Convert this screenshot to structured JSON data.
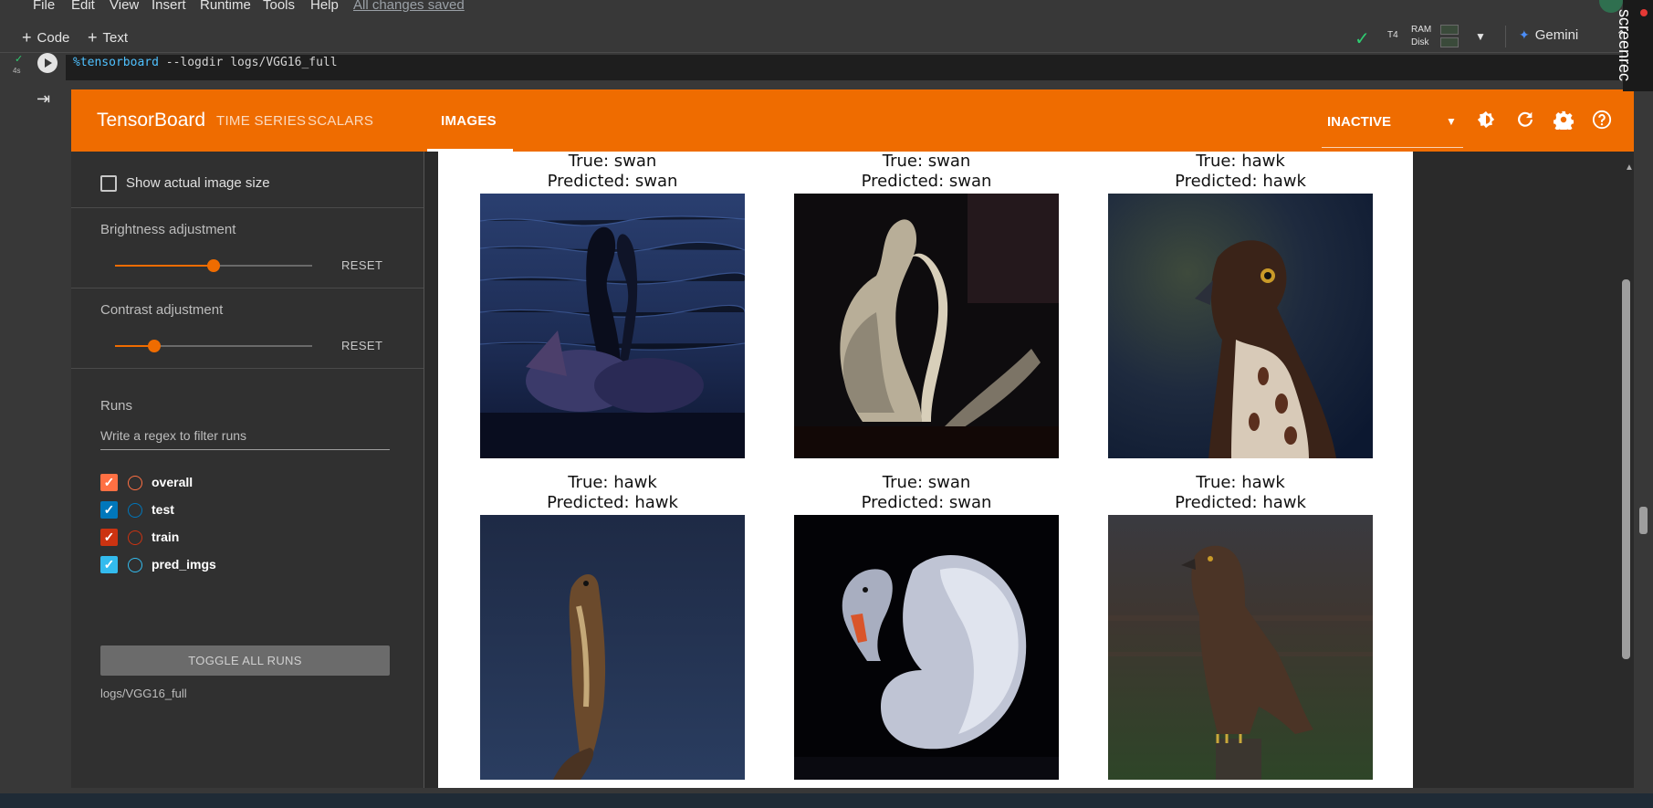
{
  "menu": {
    "items": [
      "File",
      "Edit",
      "View",
      "Insert",
      "Runtime",
      "Tools",
      "Help"
    ],
    "saved_status": "All changes saved"
  },
  "toolbar": {
    "code_label": "Code",
    "text_label": "Text",
    "gpu": "T4",
    "ram": "RAM",
    "disk": "Disk",
    "gemini_label": "Gemini"
  },
  "cell": {
    "exec_time": "4s",
    "code_magic": "%tensorboard",
    "code_args": " --logdir logs/VGG16_full"
  },
  "tensorboard": {
    "title": "TensorBoard",
    "tabs": [
      "TIME SERIES",
      "SCALARS",
      "IMAGES"
    ],
    "active_tab": "IMAGES",
    "status": "INACTIVE",
    "accent": "#ef6c00"
  },
  "sidebar": {
    "show_actual_size": "Show actual image size",
    "brightness": {
      "label": "Brightness adjustment",
      "reset": "RESET",
      "value_fraction": 0.5
    },
    "contrast": {
      "label": "Contrast adjustment",
      "reset": "RESET",
      "value_fraction": 0.2
    },
    "runs_heading": "Runs",
    "filter_placeholder": "Write a regex to filter runs",
    "runs": [
      {
        "name": "overall",
        "checked": true,
        "color": "#ff7043"
      },
      {
        "name": "test",
        "checked": true,
        "color": "#0077bb"
      },
      {
        "name": "train",
        "checked": true,
        "color": "#cc3311"
      },
      {
        "name": "pred_imgs",
        "checked": true,
        "color": "#33bbee"
      }
    ],
    "toggle_all": "TOGGLE ALL RUNS",
    "logdir": "logs/VGG16_full"
  },
  "images": [
    {
      "true": "True: swan",
      "predicted": "Predicted: swan",
      "subject": "two-swans-heart-icon"
    },
    {
      "true": "True: swan",
      "predicted": "Predicted: swan",
      "subject": "two-swans-icon"
    },
    {
      "true": "True: hawk",
      "predicted": "Predicted: hawk",
      "subject": "hawk-portrait-icon"
    },
    {
      "true": "True: hawk",
      "predicted": "Predicted: hawk",
      "subject": "hawk-perched-icon"
    },
    {
      "true": "True: swan",
      "predicted": "Predicted: swan",
      "subject": "swan-icon"
    },
    {
      "true": "True: hawk",
      "predicted": "Predicted: hawk",
      "subject": "hawk-on-post-icon"
    }
  ],
  "overlay": {
    "recorder_label": "screenrec"
  }
}
